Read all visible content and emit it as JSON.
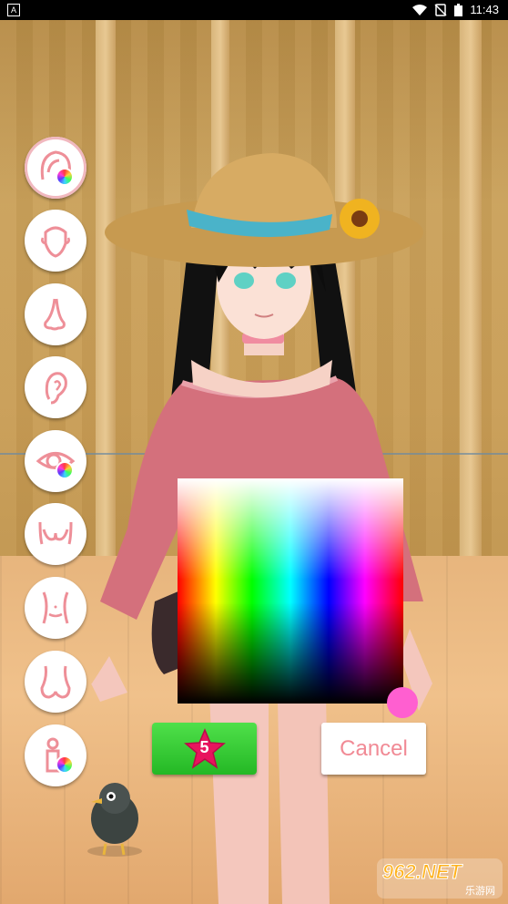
{
  "status_bar": {
    "time": "11:43",
    "left_icon": "a-notification-icon",
    "icons": [
      "wifi-icon",
      "no-sim-icon",
      "battery-icon"
    ]
  },
  "side_menu": {
    "items": [
      {
        "name": "hair",
        "icon": "hair-color-icon",
        "has_color_badge": true,
        "active": true
      },
      {
        "name": "face",
        "icon": "face-shape-icon",
        "has_color_badge": false
      },
      {
        "name": "nose",
        "icon": "nose-icon",
        "has_color_badge": false
      },
      {
        "name": "ear",
        "icon": "ear-icon",
        "has_color_badge": false
      },
      {
        "name": "eye",
        "icon": "eye-color-icon",
        "has_color_badge": true
      },
      {
        "name": "chest",
        "icon": "chest-icon",
        "has_color_badge": false
      },
      {
        "name": "waist",
        "icon": "waist-icon",
        "has_color_badge": false
      },
      {
        "name": "hips",
        "icon": "hips-icon",
        "has_color_badge": false
      },
      {
        "name": "skin",
        "icon": "body-color-icon",
        "has_color_badge": true
      }
    ]
  },
  "color_picker": {
    "selected_color": "#ff5fd0"
  },
  "buttons": {
    "star_count": "5",
    "cancel_label": "Cancel"
  },
  "watermark": {
    "top": "962.NET",
    "bottom": "乐游网"
  },
  "colors": {
    "accent_pink": "#f18a95",
    "confirm_green": "#2fc22f",
    "star_pink": "#e8145e"
  }
}
